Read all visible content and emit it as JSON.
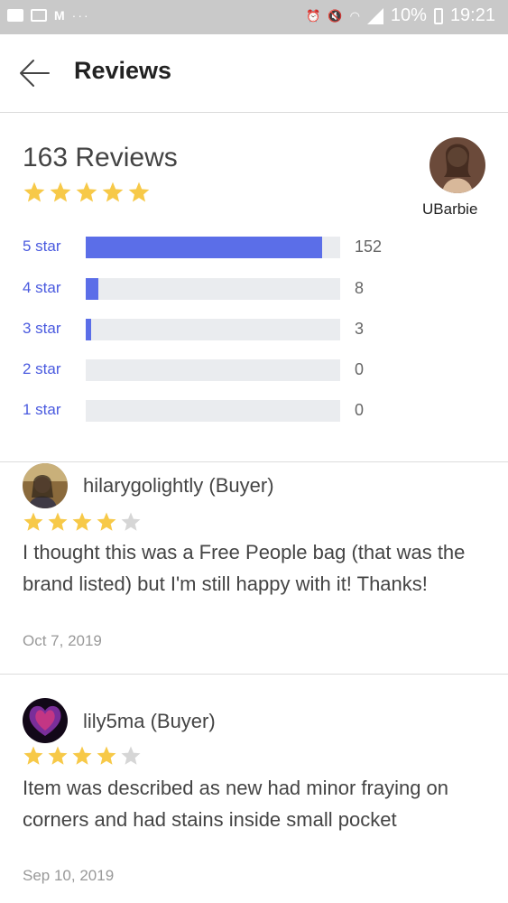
{
  "status_bar": {
    "battery": "10%",
    "time": "19:21",
    "notif_letter": "M",
    "more": "···"
  },
  "header": {
    "title": "Reviews"
  },
  "summary": {
    "count_label": "163 Reviews",
    "average_stars": 5,
    "seller_name": "UBarbie",
    "distribution": [
      {
        "label": "5 star",
        "count": "152",
        "fraction": 0.93
      },
      {
        "label": "4 star",
        "count": "8",
        "fraction": 0.05
      },
      {
        "label": "3 star",
        "count": "3",
        "fraction": 0.02
      },
      {
        "label": "2 star",
        "count": "0",
        "fraction": 0
      },
      {
        "label": "1 star",
        "count": "0",
        "fraction": 0
      }
    ]
  },
  "reviews": [
    {
      "user": "hilarygolightly (Buyer)",
      "rating": 4,
      "text": "I thought this was a Free People bag (that was the brand listed) but I'm still happy with it! Thanks!",
      "date": "Oct 7, 2019"
    },
    {
      "user": "lily5ma (Buyer)",
      "rating": 4,
      "text": "Item was described as new had minor fraying on corners and had stains inside small pocket",
      "date": "Sep 10, 2019"
    }
  ],
  "colors": {
    "star_filled": "#F7C948",
    "star_empty": "#D6D6D6",
    "bar_fill": "#5B6EE8",
    "bar_track": "#EAECEF",
    "label_blue": "#4A5ADF"
  }
}
